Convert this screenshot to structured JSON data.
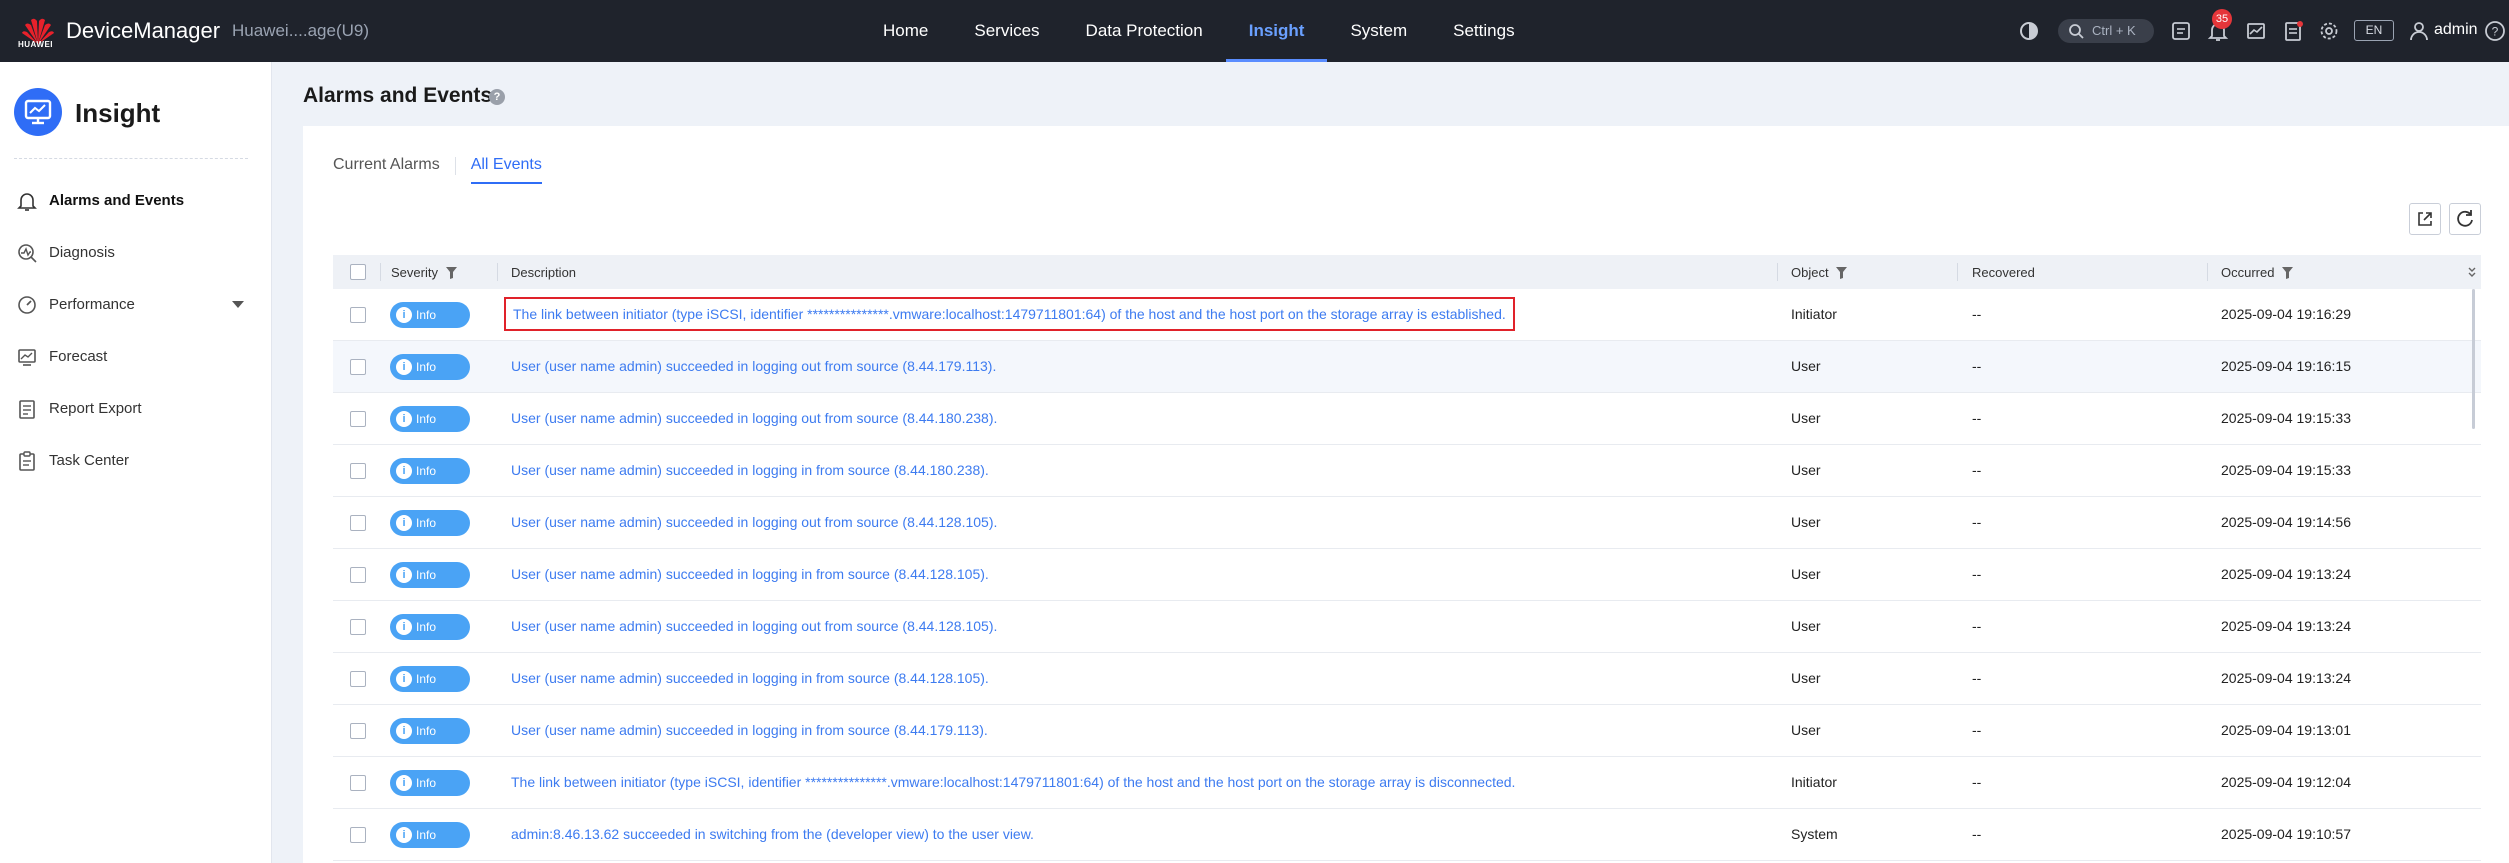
{
  "topbar": {
    "logo_text": "HUAWEI",
    "brand": "DeviceManager",
    "device": "Huawei....age(U9)",
    "nav": [
      "Home",
      "Services",
      "Data Protection",
      "Insight",
      "System",
      "Settings"
    ],
    "active_nav": "Insight",
    "search_shortcut": "Ctrl + K",
    "alarm_count": "35",
    "language": "EN",
    "user": "admin"
  },
  "sidebar": {
    "title": "Insight",
    "items": [
      {
        "label": "Alarms and Events",
        "icon": "bell-icon"
      },
      {
        "label": "Diagnosis",
        "icon": "diagnosis-icon"
      },
      {
        "label": "Performance",
        "icon": "gauge-icon"
      },
      {
        "label": "Forecast",
        "icon": "forecast-icon"
      },
      {
        "label": "Report Export",
        "icon": "report-icon"
      },
      {
        "label": "Task Center",
        "icon": "clipboard-icon"
      }
    ]
  },
  "main": {
    "title": "Alarms and Events",
    "help": "?",
    "tabs": [
      "Current Alarms",
      "All Events"
    ],
    "active_tab": "All Events",
    "table": {
      "columns": {
        "severity": "Severity",
        "description": "Description",
        "object": "Object",
        "recovered": "Recovered",
        "occurred": "Occurred"
      },
      "rows": [
        {
          "severity": "Info",
          "description": "The link between initiator (type iSCSI, identifier ***************.vmware:localhost:1479711801:64) of the host and the host port on the storage array is established.",
          "object": "Initiator",
          "recovered": "--",
          "occurred": "2025-09-04 19:16:29"
        },
        {
          "severity": "Info",
          "description": "User (user name admin) succeeded in logging out from source (8.44.179.113).",
          "object": "User",
          "recovered": "--",
          "occurred": "2025-09-04 19:16:15"
        },
        {
          "severity": "Info",
          "description": "User (user name admin) succeeded in logging out from source (8.44.180.238).",
          "object": "User",
          "recovered": "--",
          "occurred": "2025-09-04 19:15:33"
        },
        {
          "severity": "Info",
          "description": "User (user name admin) succeeded in logging in from source (8.44.180.238).",
          "object": "User",
          "recovered": "--",
          "occurred": "2025-09-04 19:15:33"
        },
        {
          "severity": "Info",
          "description": "User (user name admin) succeeded in logging out from source (8.44.128.105).",
          "object": "User",
          "recovered": "--",
          "occurred": "2025-09-04 19:14:56"
        },
        {
          "severity": "Info",
          "description": "User (user name admin) succeeded in logging in from source (8.44.128.105).",
          "object": "User",
          "recovered": "--",
          "occurred": "2025-09-04 19:13:24"
        },
        {
          "severity": "Info",
          "description": "User (user name admin) succeeded in logging out from source (8.44.128.105).",
          "object": "User",
          "recovered": "--",
          "occurred": "2025-09-04 19:13:24"
        },
        {
          "severity": "Info",
          "description": "User (user name admin) succeeded in logging in from source (8.44.128.105).",
          "object": "User",
          "recovered": "--",
          "occurred": "2025-09-04 19:13:24"
        },
        {
          "severity": "Info",
          "description": "User (user name admin) succeeded in logging in from source (8.44.179.113).",
          "object": "User",
          "recovered": "--",
          "occurred": "2025-09-04 19:13:01"
        },
        {
          "severity": "Info",
          "description": "The link between initiator (type iSCSI, identifier ***************.vmware:localhost:1479711801:64) of the host and the host port on the storage array is disconnected.",
          "object": "Initiator",
          "recovered": "--",
          "occurred": "2025-09-04 19:12:04"
        },
        {
          "severity": "Info",
          "description": "admin:8.46.13.62 succeeded in switching from the (developer view) to the user view.",
          "object": "System",
          "recovered": "--",
          "occurred": "2025-09-04 19:10:57"
        }
      ]
    }
  },
  "colors": {
    "topbar": "#1f232c",
    "accent": "#2f6df6",
    "link": "#3d7bf0",
    "info_badge": "#4aa3f5",
    "highlight_box": "#e0222a"
  }
}
